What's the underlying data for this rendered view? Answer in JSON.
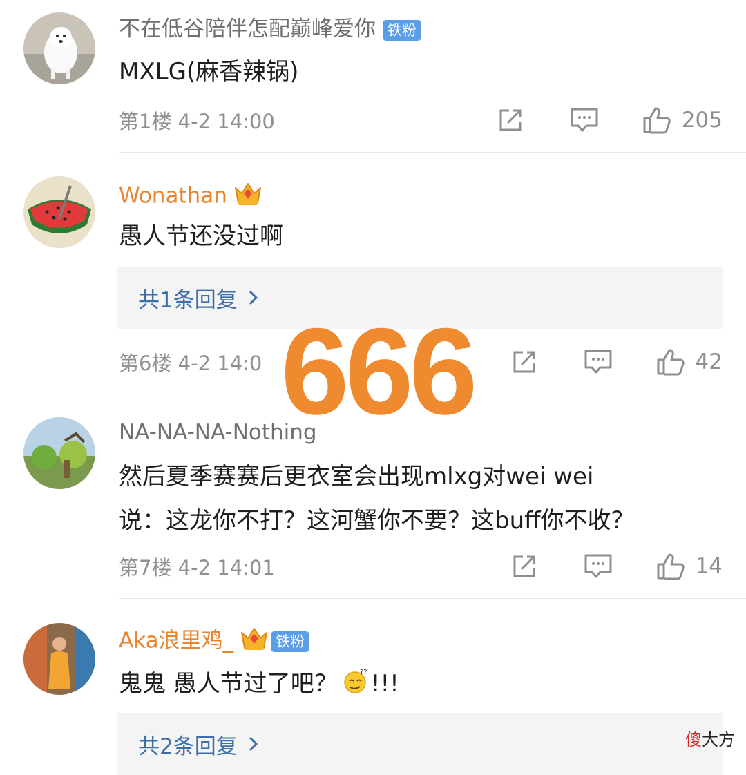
{
  "comments": [
    {
      "username": "不在低谷陪伴怎配巅峰爱你",
      "badge": "铁粉",
      "text_lines": [
        "MXLG(麻香辣锅)"
      ],
      "floor": "第1楼",
      "time": "4-2 14:00",
      "likes": "205",
      "username_color": "#707070"
    },
    {
      "username": "Wonathan",
      "text_lines": [
        "愚人节还没过啊"
      ],
      "reply_summary": "共1条回复",
      "floor": "第6楼",
      "time": "4-2 14:0",
      "likes": "42",
      "username_color": "#e8842c"
    },
    {
      "username": "NA-NA-NA-Nothing",
      "text_lines": [
        "然后夏季赛赛后更衣室会出现mlxg对wei wei",
        "说：这龙你不打？这河蟹你不要？这buff你不收？"
      ],
      "floor": "第7楼",
      "time": "4-2 14:01",
      "likes": "14",
      "username_color": "#707070"
    },
    {
      "username": "Aka浪里鸡_",
      "badge": "铁粉",
      "text_lines": [
        "鬼鬼 愚人节过了吧？",
        "!!!"
      ],
      "reply_summary": "共2条回复",
      "username_color": "#e8842c"
    }
  ],
  "overlay_text": "666",
  "watermark": {
    "first": "傻",
    "rest": "大方"
  },
  "icons": [
    "share-icon",
    "comment-icon",
    "like-icon",
    "chevron-right-icon",
    "crown-badge-icon",
    "confused-emoji-icon"
  ]
}
